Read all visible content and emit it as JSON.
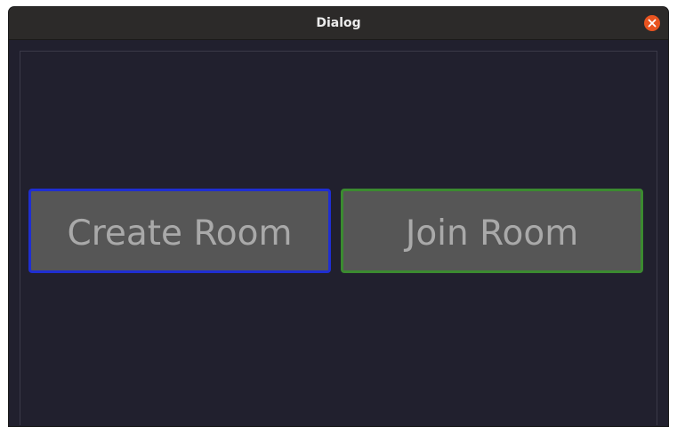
{
  "window": {
    "title": "Dialog",
    "close_icon": "close-icon"
  },
  "buttons": {
    "create_room": "Create Room",
    "join_room": "Join Room"
  },
  "colors": {
    "titlebar": "#2c2a29",
    "background": "#21202e",
    "close_button": "#e95420",
    "button_fill": "#565656",
    "button_text": "#a9a9a9",
    "create_border": "#1f2ed2",
    "join_border": "#3b8a30"
  }
}
